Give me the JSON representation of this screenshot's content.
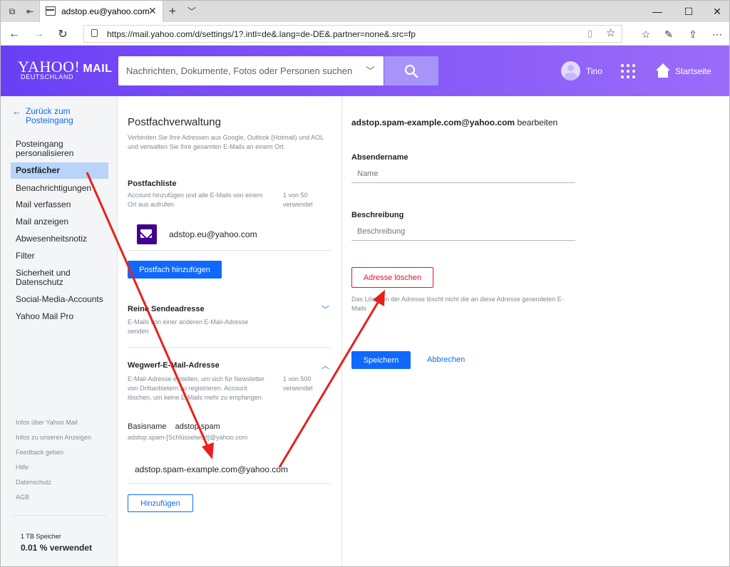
{
  "browser": {
    "tab_title": "adstop.eu@yahoo.com",
    "url": "https://mail.yahoo.com/d/settings/1?.intl=de&.lang=de-DE&.partner=none&.src=fp",
    "window_controls": [
      "minimize-icon",
      "maximize-icon",
      "close-icon"
    ]
  },
  "header": {
    "logo_text": "YAHOO!",
    "logo_mail": "MAIL",
    "logo_sub": "DEUTSCHLAND",
    "search_placeholder": "Nachrichten, Dokumente, Fotos oder Personen suchen",
    "user_name": "Tino",
    "home_label": "Startseite",
    "brand_gradient": [
      "#6a3ff5",
      "#9b6cf9"
    ],
    "search_button_color": "#a894f9"
  },
  "sidebar": {
    "back_label": "Zurück zum Posteingang",
    "items": [
      {
        "label": "Posteingang personalisieren",
        "active": false
      },
      {
        "label": "Postfächer",
        "active": true
      },
      {
        "label": "Benachrichtigungen",
        "active": false
      },
      {
        "label": "Mail verfassen",
        "active": false
      },
      {
        "label": "Mail anzeigen",
        "active": false
      },
      {
        "label": "Abwesenheitsnotiz",
        "active": false
      },
      {
        "label": "Filter",
        "active": false
      },
      {
        "label": "Sicherheit und Datenschutz",
        "active": false
      },
      {
        "label": "Social-Media-Accounts",
        "active": false
      },
      {
        "label": "Yahoo Mail Pro",
        "active": false
      }
    ],
    "footer_links": [
      "Infos über Yahoo Mail",
      "Infos zu unseren Anzeigen",
      "Feedback geben",
      "Hilfe",
      "Datenschutz",
      "AGB"
    ],
    "storage_total": "1 TB Speicher",
    "storage_used": "0.01 % verwendet"
  },
  "middle": {
    "title": "Postfachverwaltung",
    "intro": "Verbinden Sie Ihre Adressen aus Google, Outlook (Hotmail) und AOL und verwalten Sie Ihre gesamten E-Mails an einem Ort.",
    "mailbox_list": {
      "heading": "Postfachliste",
      "desc": "Account hinzufügen und alle E-Mails von einem Ort aus aufrufen",
      "count": "1 von 50 verwendet",
      "account": "adstop.eu@yahoo.com",
      "add_button": "Postfach hinzufügen"
    },
    "send_only": {
      "heading": "Reine Sendeadresse",
      "desc": "E-Mails von einer anderen E-Mail-Adresse senden"
    },
    "disposable": {
      "heading": "Wegwerf-E-Mail-Adresse",
      "desc": "E-Mail-Adresse erstellen, um sich für Newsletter von Drittanbietern zu registrieren. Account löschen, um keine E-Mails mehr zu empfangen.",
      "count": "1 von 500 verwendet",
      "basename_label": "Basisname",
      "basename_value": "adstop.spam",
      "pattern": "adstop.spam-[Schlüsselwort]@yahoo.com",
      "address": "adstop.spam-example.com@yahoo.com",
      "add_button": "Hinzufügen"
    }
  },
  "editor": {
    "address": "adstop.spam-example.com@yahoo.com",
    "title_suffix": "bearbeiten",
    "sender_label": "Absendername",
    "sender_placeholder": "Name",
    "desc_label": "Beschreibung",
    "desc_placeholder": "Beschreibung",
    "delete_button": "Adresse löschen",
    "delete_note": "Das Löschen der Adresse löscht nicht die an diese Adresse gesendeten E-Mails",
    "save_button": "Speichern",
    "cancel_button": "Abbrechen",
    "danger_color": "#eb0f29",
    "accent_color": "#0f69ff"
  },
  "annotation_arrow_color": "#e8201a"
}
